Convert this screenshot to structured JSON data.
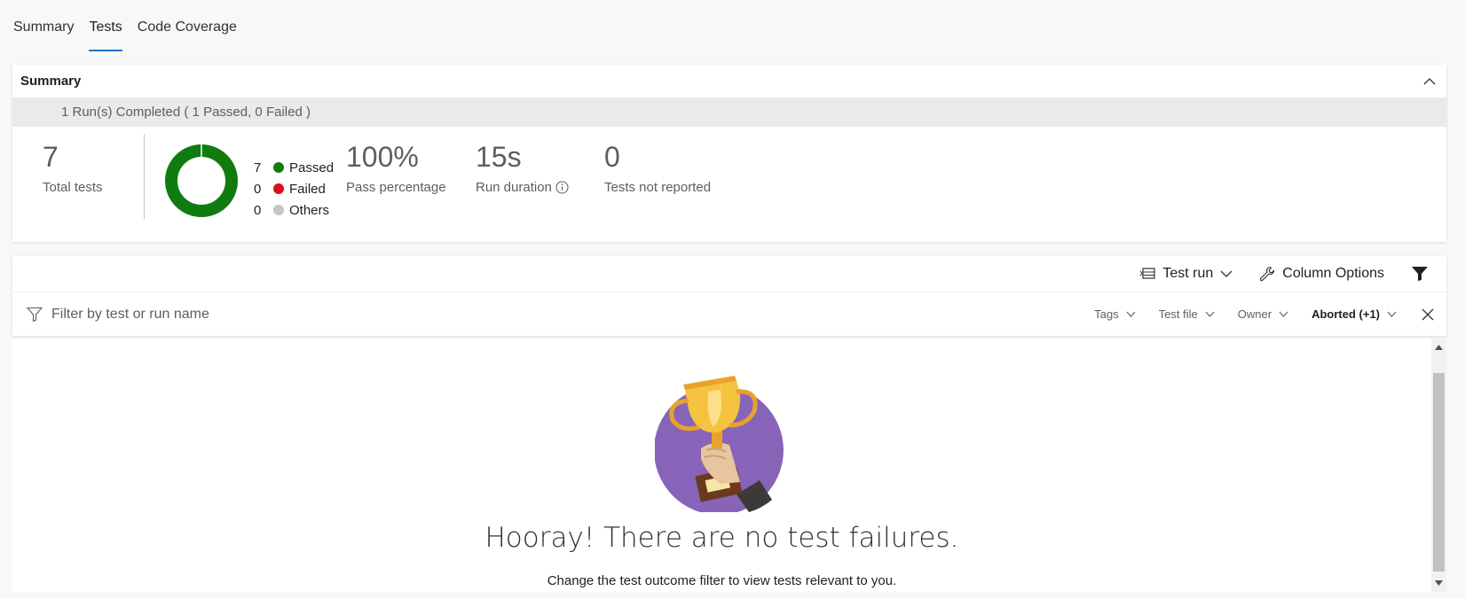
{
  "tabs": [
    {
      "label": "Summary",
      "active": false
    },
    {
      "label": "Tests",
      "active": true
    },
    {
      "label": "Code Coverage",
      "active": false
    }
  ],
  "summary": {
    "title": "Summary",
    "runs_text": "1 Run(s) Completed ( 1 Passed, 0 Failed )",
    "total_tests": {
      "value": "7",
      "label": "Total tests"
    },
    "legend": [
      {
        "count": "7",
        "label": "Passed",
        "color": "#107c10"
      },
      {
        "count": "0",
        "label": "Failed",
        "color": "#e00b1c"
      },
      {
        "count": "0",
        "label": "Others",
        "color": "#c8c6c4"
      }
    ],
    "pass_percentage": {
      "value": "100%",
      "label": "Pass percentage"
    },
    "run_duration": {
      "value": "15s",
      "label": "Run duration"
    },
    "tests_not_reported": {
      "value": "0",
      "label": "Tests not reported"
    }
  },
  "toolbar": {
    "test_run_label": "Test run",
    "column_options_label": "Column Options"
  },
  "filter": {
    "placeholder": "Filter by test or run name",
    "pills": {
      "tags": "Tags",
      "test_file": "Test file",
      "owner": "Owner",
      "outcome": "Aborted (+1)"
    }
  },
  "results": {
    "headline": "Hooray! There are no test failures.",
    "hint": "Change the test outcome filter to view tests relevant to you."
  },
  "colors": {
    "accent": "#0078d4",
    "passed": "#107c10",
    "failed": "#e00b1c",
    "others": "#c8c6c4",
    "trophy_bg": "#8764b8"
  },
  "icons": [
    "chevron-up-icon",
    "info-icon",
    "test-run-icon",
    "chevron-down-icon",
    "wrench-icon",
    "filter-funnel-icon",
    "funnel-outline-icon",
    "close-icon",
    "scroll-up-icon",
    "scroll-down-icon",
    "trophy-illustration"
  ]
}
